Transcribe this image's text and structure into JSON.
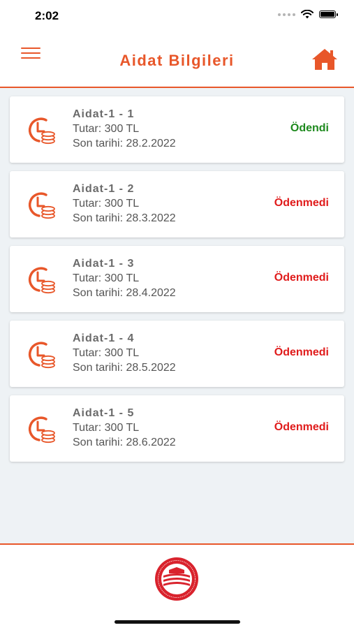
{
  "status_bar": {
    "time": "2:02"
  },
  "header": {
    "title": "Aidat Bilgileri"
  },
  "colors": {
    "accent": "#e8572a",
    "paid": "#1e8a1e",
    "unpaid": "#e01b1b"
  },
  "items": [
    {
      "title": "Aidat-1 - 1",
      "amount": "Tutar: 300 TL",
      "due": "Son tarihi: 28.2.2022",
      "status": "Ödendi",
      "paid": true
    },
    {
      "title": "Aidat-1 - 2",
      "amount": "Tutar: 300 TL",
      "due": "Son tarihi: 28.3.2022",
      "status": "Ödenmedi",
      "paid": false
    },
    {
      "title": "Aidat-1 - 3",
      "amount": "Tutar: 300 TL",
      "due": "Son tarihi: 28.4.2022",
      "status": "Ödenmedi",
      "paid": false
    },
    {
      "title": "Aidat-1 - 4",
      "amount": "Tutar: 300 TL",
      "due": "Son tarihi: 28.5.2022",
      "status": "Ödenmedi",
      "paid": false
    },
    {
      "title": "Aidat-1 - 5",
      "amount": "Tutar: 300 TL",
      "due": "Son tarihi: 28.6.2022",
      "status": "Ödenmedi",
      "paid": false
    }
  ],
  "icons": {
    "menu": "hamburger-menu-icon",
    "home": "home-icon",
    "item": "clock-coins-icon",
    "logo": "association-logo"
  },
  "footer": {
    "logo_text_top": "MODERN ORTADOĞU",
    "logo_text_bottom": "MEZUNLAR DERNEĞİ"
  }
}
